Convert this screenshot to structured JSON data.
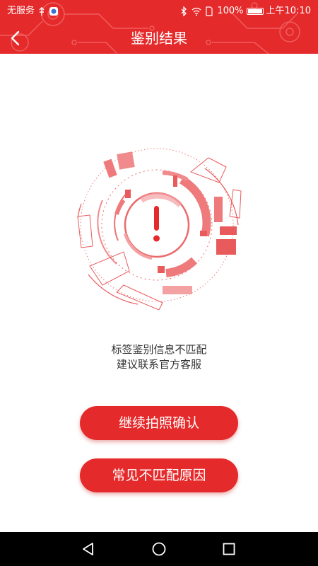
{
  "status_bar": {
    "carrier": "无服务",
    "battery": "100%",
    "time": "上午10:10"
  },
  "header": {
    "title": "鉴别结果",
    "back_icon": "chevron-left-icon",
    "background": "#e52a2b"
  },
  "result": {
    "icon": "alert-exclamation-icon",
    "message_line1": "标签鉴别信息不匹配",
    "message_line2": "建议联系官方客服"
  },
  "actions": {
    "confirm_label": "继续拍照确认",
    "reasons_label": "常见不匹配原因"
  },
  "colors": {
    "accent": "#e52a2b",
    "text": "#333333"
  },
  "system_nav": {
    "back_icon": "triangle-back-icon",
    "home_icon": "circle-home-icon",
    "recents_icon": "square-recents-icon"
  }
}
